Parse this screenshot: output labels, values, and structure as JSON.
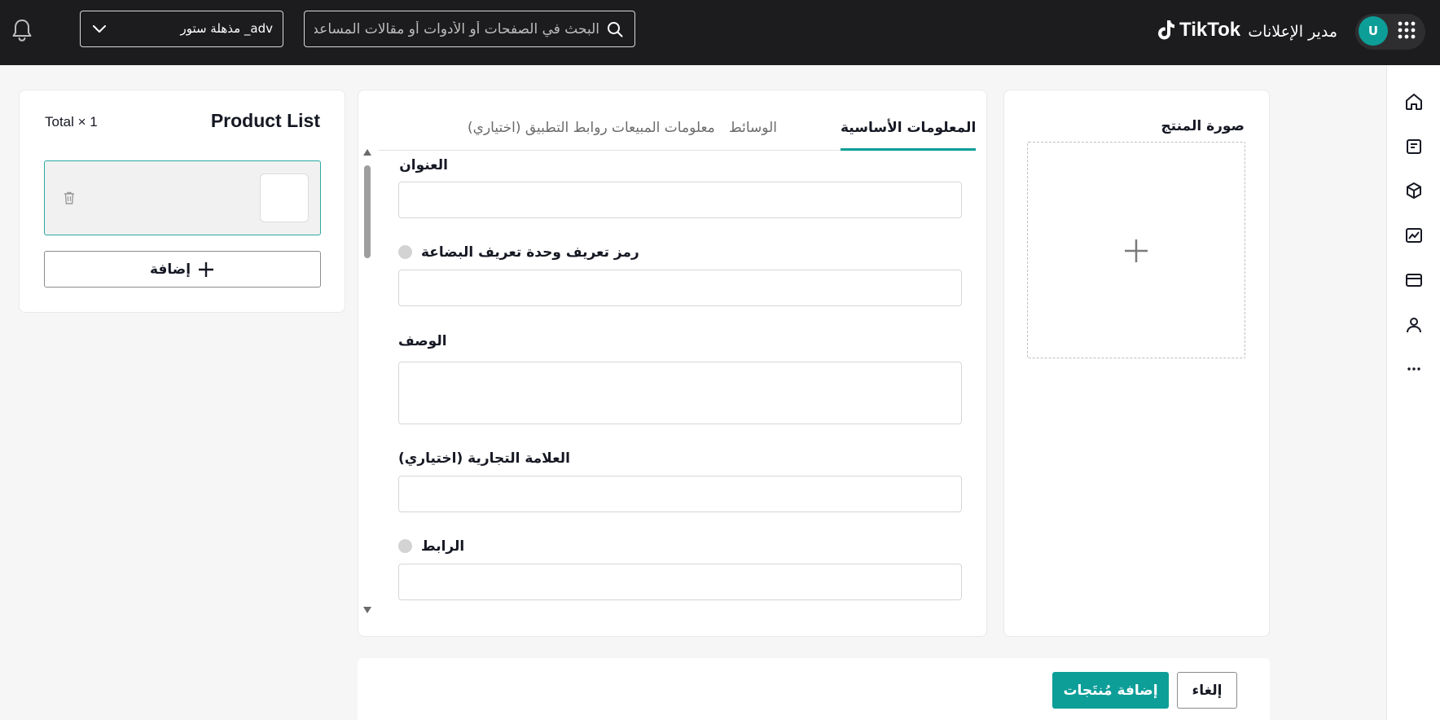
{
  "header": {
    "app_title": "مدير الإعلانات",
    "brand": "TikTok",
    "avatar_initial": "U",
    "search_placeholder": "البحث في الصفحات أو الأدوات أو مقالات المساعدة",
    "account_name": "مذهلة ستور _adv",
    "icons": [
      "apps-grid-icon",
      "tiktok-logo-icon",
      "search-icon",
      "chevron-down-icon",
      "bell-icon"
    ]
  },
  "sidenav": {
    "items": [
      "home-icon",
      "campaign-icon",
      "catalog-icon",
      "analytics-icon",
      "billing-icon",
      "account-icon",
      "more-icon"
    ]
  },
  "image_panel": {
    "label": "صورة المنتج"
  },
  "form": {
    "tabs": [
      "المعلومات الأساسية",
      "الوسائط",
      "معلومات المبيعات",
      "روابط التطبيق (اختياري)"
    ],
    "active_tab": 0,
    "fields": {
      "title_label": "العنوان",
      "sku_label": "رمز تعريف وحدة تعريف البضاعة",
      "description_label": "الوصف",
      "brand_label": "العلامة التجارية  (اختياري)",
      "link_label": "الرابط"
    }
  },
  "product_list": {
    "title": "Product List",
    "total": "Total × 1",
    "add_label": "إضافة"
  },
  "footer": {
    "submit_label": "إضافة مُنتَجات",
    "cancel_label": "إلغاء"
  },
  "colors": {
    "accent": "#0d9e98",
    "topbar": "#1c1c1e",
    "background": "#f6f6f6"
  }
}
